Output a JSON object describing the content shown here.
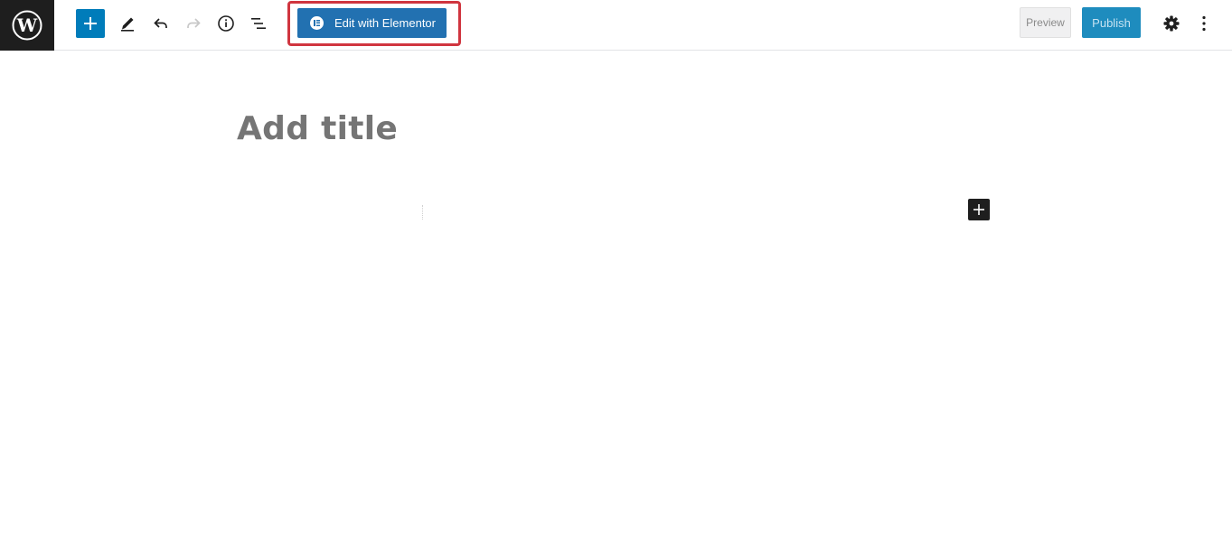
{
  "toolbar": {
    "logo_icon": "wordpress-logo-icon",
    "add_block_icon": "plus-icon",
    "tools_icon": "pencil-icon",
    "undo_icon": "undo-icon",
    "redo_icon": "redo-icon",
    "details_icon": "info-icon",
    "outline_icon": "list-view-icon",
    "elementor_label": "Edit with Elementor",
    "elementor_icon": "elementor-icon",
    "preview_label": "Preview",
    "publish_label": "Publish",
    "settings_icon": "gear-icon",
    "more_icon": "more-vertical-icon",
    "highlight_color": "#d0353f",
    "accent_color": "#007cba"
  },
  "editor": {
    "title_placeholder": "Add title",
    "inserter_icon": "plus-icon"
  }
}
